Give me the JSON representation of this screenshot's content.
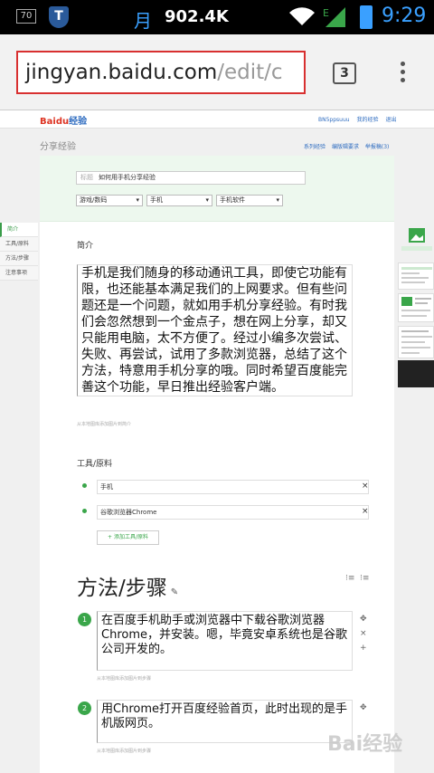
{
  "status_bar": {
    "notif_badge": "70",
    "moon_char": "月",
    "speed": "902.4K",
    "clock": "9:29",
    "icons": [
      "shield-icon",
      "wifi-icon",
      "signal-icon",
      "battery-icon"
    ]
  },
  "browser": {
    "url_host": "jingyan.baidu.com",
    "url_path": "/edit/c",
    "tab_count": "3"
  },
  "header": {
    "logo_bai": "Bai",
    "logo_du": "du",
    "logo_jy": "经验",
    "links": [
      "BN5ppsuuu",
      "我的经验",
      "退出"
    ]
  },
  "share": {
    "title": "分享经验",
    "links": [
      "系列经验",
      "编版辑要求",
      "举报稿(3)"
    ]
  },
  "side_nav": [
    "简介",
    "工具/原料",
    "方法/步骤",
    "注意事项"
  ],
  "form": {
    "title_label": "标题",
    "title_value": "如何用手机分享经验",
    "cat1": "游戏/数码",
    "cat2": "手机",
    "cat3": "手机软件"
  },
  "intro": {
    "label": "简介",
    "text": "手机是我们随身的移动通讯工具，即使它功能有限，也还能基本满足我们的上网要求。但有些问题还是一个问题，就如用手机分享经验。有时我们会忽然想到一个金点子，想在网上分享，却又只能用电脑，太不方便了。经过小编多次尝试、失败、再尝试，试用了多款浏览器，总结了这个方法，特意用手机分享的哦。同时希望百度能完善这个功能，早日推出经验客户端。",
    "img_hint": "从本地图库添加图片到简介"
  },
  "tools": {
    "label": "工具/原料",
    "items": [
      "手机",
      "谷歌浏览器Chrome"
    ],
    "add_label": "+ 添加工具/原料"
  },
  "method": {
    "title": "方法/步骤",
    "steps": [
      {
        "num": "1",
        "text": "在百度手机助手或浏览器中下载谷歌浏览器Chrome，并安装。嗯，毕竟安卓系统也是谷歌公司开发的。",
        "img_hint": "从本地图库添加图片到步骤"
      },
      {
        "num": "2",
        "text": "用Chrome打开百度经验首页，此时出现的是手机版网页。",
        "img_hint": "从本地图库添加图片到步骤"
      }
    ]
  },
  "watermark": "Bai经验"
}
